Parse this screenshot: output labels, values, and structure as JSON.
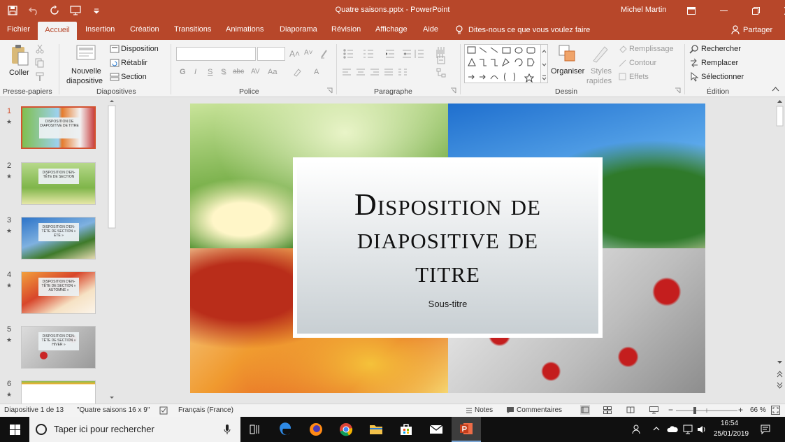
{
  "window": {
    "title": "Quatre saisons.pptx  -  PowerPoint",
    "user": "Michel Martin"
  },
  "tabs": [
    "Fichier",
    "Accueil",
    "Insertion",
    "Création",
    "Transitions",
    "Animations",
    "Diaporama",
    "Révision",
    "Affichage",
    "Aide"
  ],
  "active_tab": "Accueil",
  "tell_me": "Dites-nous ce que vous voulez faire",
  "share": "Partager",
  "ribbon": {
    "groups": [
      "Presse-papiers",
      "Diapositives",
      "Police",
      "Paragraphe",
      "Dessin",
      "Édition"
    ],
    "paste": "Coller",
    "new_slide": [
      "Nouvelle",
      "diapositive"
    ],
    "layout": "Disposition",
    "reset": "Rétablir",
    "section": "Section",
    "font_buttons": [
      "G",
      "I",
      "S",
      "S",
      "abc",
      "AV",
      "Aa",
      "A"
    ],
    "arrange": "Organiser",
    "quick_styles": [
      "Styles",
      "rapides"
    ],
    "fill": "Remplissage",
    "outline": "Contour",
    "effects": "Effets",
    "find": "Rechercher",
    "replace": "Remplacer",
    "select": "Sélectionner"
  },
  "thumbnails": [
    {
      "num": "1",
      "text": "DISPOSITION DE DIAPOSITIVE DE TITRE"
    },
    {
      "num": "2",
      "text": "DISPOSITION D'EN-TÊTE DE SECTION"
    },
    {
      "num": "3",
      "text": "DISPOSITION D'EN-TÊTE DE SECTION « ÉTÉ »"
    },
    {
      "num": "4",
      "text": "DISPOSITION D'EN-TÊTE DE SECTION « AUTOMNE »"
    },
    {
      "num": "5",
      "text": "DISPOSITION D'EN-TÊTE DE SECTION « HIVER »"
    },
    {
      "num": "6",
      "text": ""
    }
  ],
  "slide": {
    "title_lines": [
      "Disposition de",
      "diapositive de",
      "titre"
    ],
    "subtitle": "Sous-titre"
  },
  "status": {
    "slide_info": "Diapositive 1 de 13",
    "theme": "\"Quatre saisons 16 x 9\"",
    "language": "Français (France)",
    "notes": "Notes",
    "comments": "Commentaires",
    "zoom": "66 %"
  },
  "taskbar": {
    "search_placeholder": "Taper ici pour rechercher",
    "time": "16:54",
    "date": "25/01/2019"
  }
}
